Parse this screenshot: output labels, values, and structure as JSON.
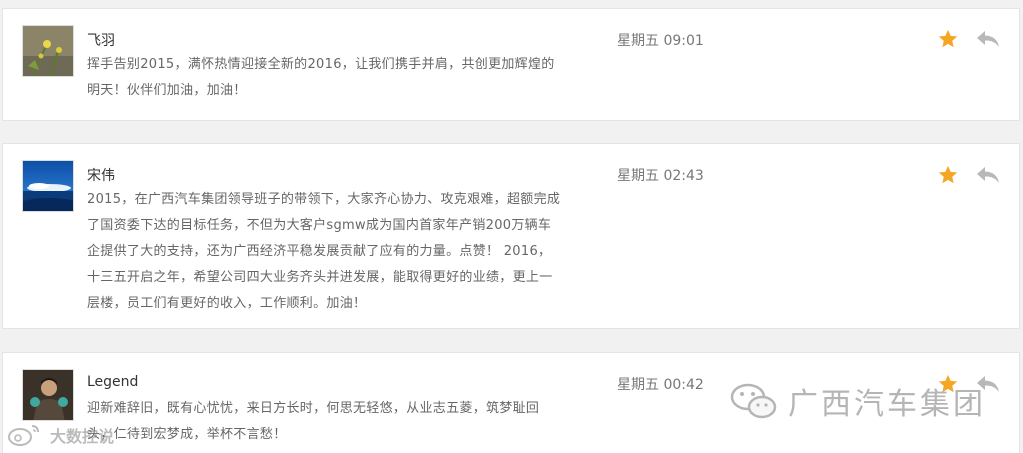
{
  "comments": [
    {
      "author": "飞羽",
      "time": "星期五 09:01",
      "lines": [
        "挥手告别2015，满怀热情迎接全新的2016，让我们携手并肩，共创更加辉煌的",
        "明天！伙伴们加油，加油！"
      ],
      "avatar": "grass-flower-photo"
    },
    {
      "author": "宋伟",
      "time": "星期五 02:43",
      "lines": [
        "2015，在广西汽车集团领导班子的带领下，大家齐心协力、攻克艰难，超额完成",
        "了国资委下达的目标任务，不但为大客户sgmw成为国内首家年产销200万辆车",
        "企提供了大的支持，还为广西经济平稳发展贡献了应有的力量。点赞！ 2016，",
        "十三五开启之年，希望公司四大业务齐头并进发展，能取得更好的业绩，更上一",
        "层楼，员工们有更好的收入，工作顺利。加油！"
      ],
      "avatar": "sea-sky-photo"
    },
    {
      "author": "Legend",
      "time": "星期五 00:42",
      "lines": [
        "迎新难辞旧，既有心忧忧，来日方长时，何思无轻悠，从业志五菱，筑梦耻回",
        "头，仁待到宏梦成，举杯不言愁！"
      ],
      "avatar": "person-photo"
    }
  ],
  "watermark": {
    "text": "广西汽车集团",
    "icon": "wechat-icon"
  },
  "corner_watermark": {
    "text": "大数控说",
    "icon": "weibo-icon"
  },
  "colors": {
    "star": "#f5a623",
    "reply": "#b8b8b8",
    "background": "#f1f1f1"
  }
}
